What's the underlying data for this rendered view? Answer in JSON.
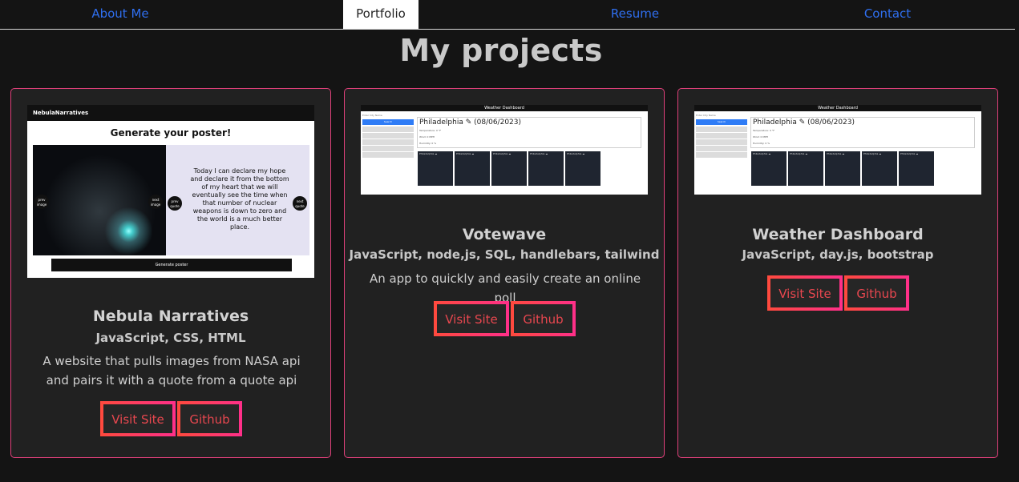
{
  "nav": {
    "items": [
      "About Me",
      "Portfolio",
      "Resume",
      "Contact"
    ],
    "active": "Portfolio"
  },
  "page_title": "My projects",
  "colors": {
    "accent_border": "#e0407a",
    "link": "#2f6ff0",
    "button_text": "#e8474f"
  },
  "projects": [
    {
      "title": "Nebula Narratives",
      "tech": "JavaScript, CSS, HTML",
      "description": "A website that pulls images from NASA api and pairs it with a quote from a quote api",
      "visit_label": "Visit Site",
      "github_label": "Github",
      "preview": {
        "app_name": "NebulaNarratives",
        "heading": "Generate your poster!",
        "quote": "Today I can declare my hope and declare it from the bottom of my heart that we will eventually see the time when that number of nuclear weapons is down to zero and the world is a much better place.",
        "prev_image": "prev image",
        "next_image": "next image",
        "prev_quote": "prev quote",
        "next_quote": "next quote",
        "generate": "Generate poster"
      }
    },
    {
      "title": "Votewave",
      "tech": "JavaScript, node,js, SQL, handlebars, tailwind",
      "description": "An app to quickly and easily create an online poll",
      "visit_label": "Visit Site",
      "github_label": "Github",
      "preview": {
        "header": "Weather Dashboard",
        "city": "Philadelphia",
        "date": "(08/06/2023)",
        "search": "Search"
      }
    },
    {
      "title": "Weather Dashboard",
      "tech": "JavaScript, day.js, bootstrap",
      "description": "",
      "visit_label": "Visit Site",
      "github_label": "Github",
      "preview": {
        "header": "Weather Dashboard",
        "city": "Philadelphia",
        "date": "(08/06/2023)",
        "search": "Search"
      }
    }
  ]
}
